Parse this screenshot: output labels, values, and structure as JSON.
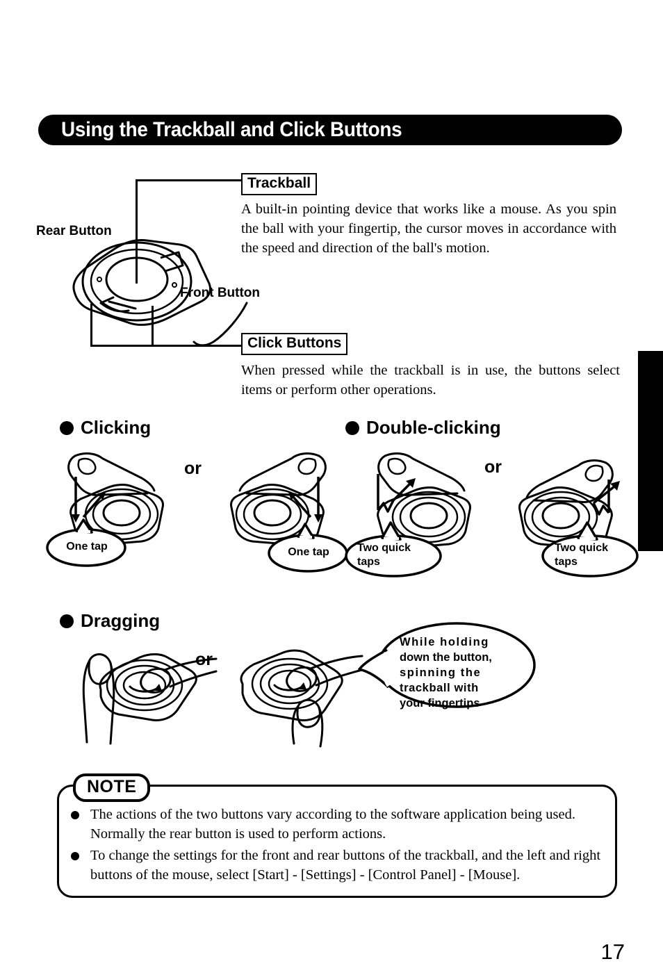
{
  "header": {
    "title": "Using the Trackball and Click Buttons"
  },
  "diagram": {
    "rear_button_label": "Rear Button",
    "front_button_label": "Front Button"
  },
  "sections": {
    "trackball": {
      "label": "Trackball",
      "description": "A built-in pointing device that works like a mouse. As you spin the ball with your fingertip, the cursor moves in accordance with the speed and direction of the ball's motion."
    },
    "click_buttons": {
      "label": "Click Buttons",
      "description": "When pressed while the trackball is in use, the buttons select items or perform other operations."
    },
    "clicking": {
      "heading": "Clicking",
      "or": "or",
      "callout_left": "One tap",
      "callout_right": "One tap"
    },
    "double_clicking": {
      "heading": "Double-clicking",
      "or": "or",
      "callout_left_line1": "Two quick",
      "callout_left_line2": "taps",
      "callout_right_line1": "Two quick",
      "callout_right_line2": "taps"
    },
    "dragging": {
      "heading": "Dragging",
      "or": "or",
      "balloon_line1": "While holding",
      "balloon_line2": "down the button,",
      "balloon_line3": "spinning the",
      "balloon_line4": "trackball with",
      "balloon_line5": "your fingertips"
    }
  },
  "note": {
    "label": "NOTE",
    "items": [
      "The actions of the two buttons vary according to the software application being used.  Normally the rear button is used to perform actions.",
      "To change the settings for the front and rear buttons of the trackball, and the left and right buttons of the mouse, select [Start] - [Settings] - [Control Panel] - [Mouse]."
    ]
  },
  "footer": {
    "page_number": "17"
  },
  "colors": {
    "ink": "#000000",
    "paper": "#ffffff"
  }
}
